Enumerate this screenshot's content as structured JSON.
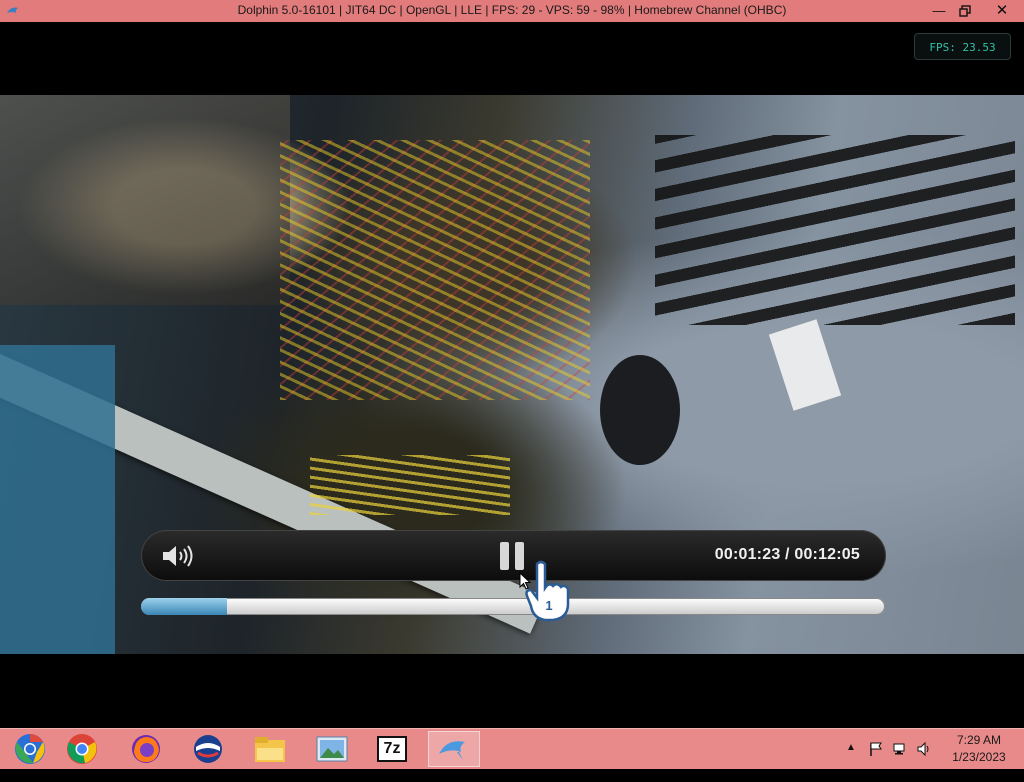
{
  "window": {
    "title": "Dolphin 5.0-16101 | JIT64 DC | OpenGL | LLE | FPS: 29 - VPS: 59 - 98% | Homebrew Channel (OHBC)",
    "controls": [
      "minimize-icon",
      "maximize-icon",
      "close-icon"
    ]
  },
  "overlay": {
    "fps": "FPS: 23.53"
  },
  "player": {
    "timecode": "00:01:23 / 00:12:05",
    "progress_fraction": 0.115,
    "icons": [
      "speaker-icon",
      "pause-icon",
      "wiimote-hand-cursor-icon"
    ],
    "cursor_label": "1"
  },
  "taskbar": {
    "apps": [
      {
        "name": "chrome-beta-icon"
      },
      {
        "name": "chrome-icon"
      },
      {
        "name": "firefox-icon"
      },
      {
        "name": "obs-icon"
      },
      {
        "name": "file-explorer-icon"
      },
      {
        "name": "photos-icon"
      },
      {
        "name": "7zip-icon",
        "text": "7z"
      },
      {
        "name": "dolphin-icon",
        "active": true
      }
    ],
    "clock": {
      "time": "7:29 AM",
      "date": "1/23/2023"
    }
  },
  "colors": {
    "titlebar": "#e27b7b",
    "taskbar": "#e98a8a",
    "fps_text": "#2fc2a8",
    "seek_fill": "#3a86b5"
  }
}
